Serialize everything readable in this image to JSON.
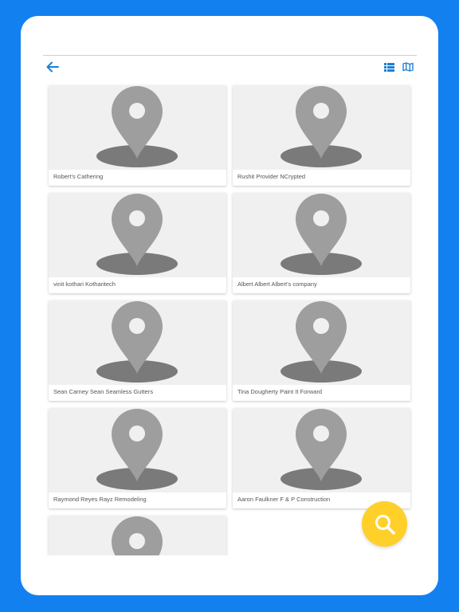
{
  "colors": {
    "background": "#1380f0",
    "accent": "#1e7fd2",
    "fab": "#ffd02a",
    "placeholder_bg": "#f0f0f0",
    "pin": "#9e9e9e",
    "pin_shadow": "#7a7a7a"
  },
  "toolbar": {
    "back_icon": "arrow-left-icon",
    "list_icon": "list-icon",
    "map_icon": "map-icon"
  },
  "listings": [
    {
      "name": "Robert's Cathering"
    },
    {
      "name": "Rushit Provider NCrypted"
    },
    {
      "name": "vinit kothari Kotharitech"
    },
    {
      "name": "Albert Albert Albert's company"
    },
    {
      "name": "Sean Carney Sean Seamless Gutters"
    },
    {
      "name": "Tina Dougherty Paint It Forward"
    },
    {
      "name": "Raymond Reyes Rayz Remodeling"
    },
    {
      "name": "Aaron Faulkner F & P Construction"
    },
    {
      "name": ""
    }
  ],
  "fab": {
    "icon": "search-icon"
  }
}
